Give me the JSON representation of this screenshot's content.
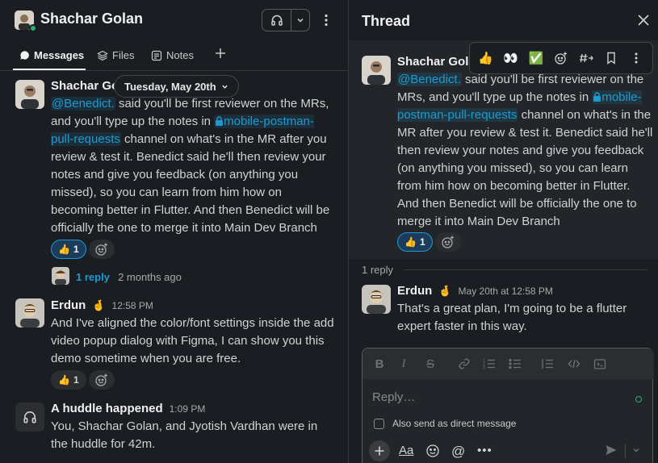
{
  "channel": {
    "title": "Shachar Golan",
    "tabs": [
      {
        "label": "Messages",
        "active": true
      },
      {
        "label": "Files",
        "active": false
      },
      {
        "label": "Notes",
        "active": false
      }
    ],
    "date_divider": "Tuesday, May 20th"
  },
  "messages": [
    {
      "author": "Shachar Gol",
      "mention": "@Benedict.",
      "text_a": " said you'll be first reviewer on the MRs, and you'll type up the notes in ",
      "channel_link": "mobile-postman-pull-requests",
      "text_b": " channel on what's in the MR after you review & test it. Benedict said he'll then review your notes and give you feedback (on anything you missed), so you can learn from him how on becoming better in Flutter. And then Benedict will be officially the one to merge it into Main Dev Branch",
      "reaction_count": "1",
      "reply_label": "1 reply",
      "reply_age": "2 months ago"
    },
    {
      "author": "Erdun",
      "author_emoji": "🤞",
      "time": "12:58 PM",
      "text": "And I've aligned the color/font settings inside the add video popup dialog with Figma, I can show you this demo sometime when you are free.",
      "reaction_count": "1"
    },
    {
      "author": "A huddle happened",
      "time": "1:09 PM",
      "text": "You, Shachar Golan, and Jyotish Vardhan were in the huddle for 42m."
    }
  ],
  "thread": {
    "title": "Thread",
    "parent": {
      "author": "Shachar Golan",
      "mention": "@Benedict.",
      "text_a": " said you'll be first reviewer on the MRs, and you'll type up the notes in ",
      "channel_link": "mobile-postman-pull-requests",
      "text_b": " channel on what's in the MR after you review & test it. Benedict said he'll then review your notes and give you feedback (on anything you missed), so you can learn from him how on becoming better in Flutter. And then Benedict will be officially the one to merge it into Main Dev Branch",
      "reaction_count": "1"
    },
    "replies_label": "1 reply",
    "reply": {
      "author": "Erdun",
      "author_emoji": "🤞",
      "time": "May 20th at 12:58 PM",
      "text": "That's a great plan, I'm going to be a flutter expert faster in this way."
    },
    "composer": {
      "placeholder": "Reply…",
      "also_send": "Also send as direct message"
    }
  },
  "colors": {
    "link": "#1d9bd1",
    "presence": "#2bac76",
    "background": "#1a1d21"
  }
}
